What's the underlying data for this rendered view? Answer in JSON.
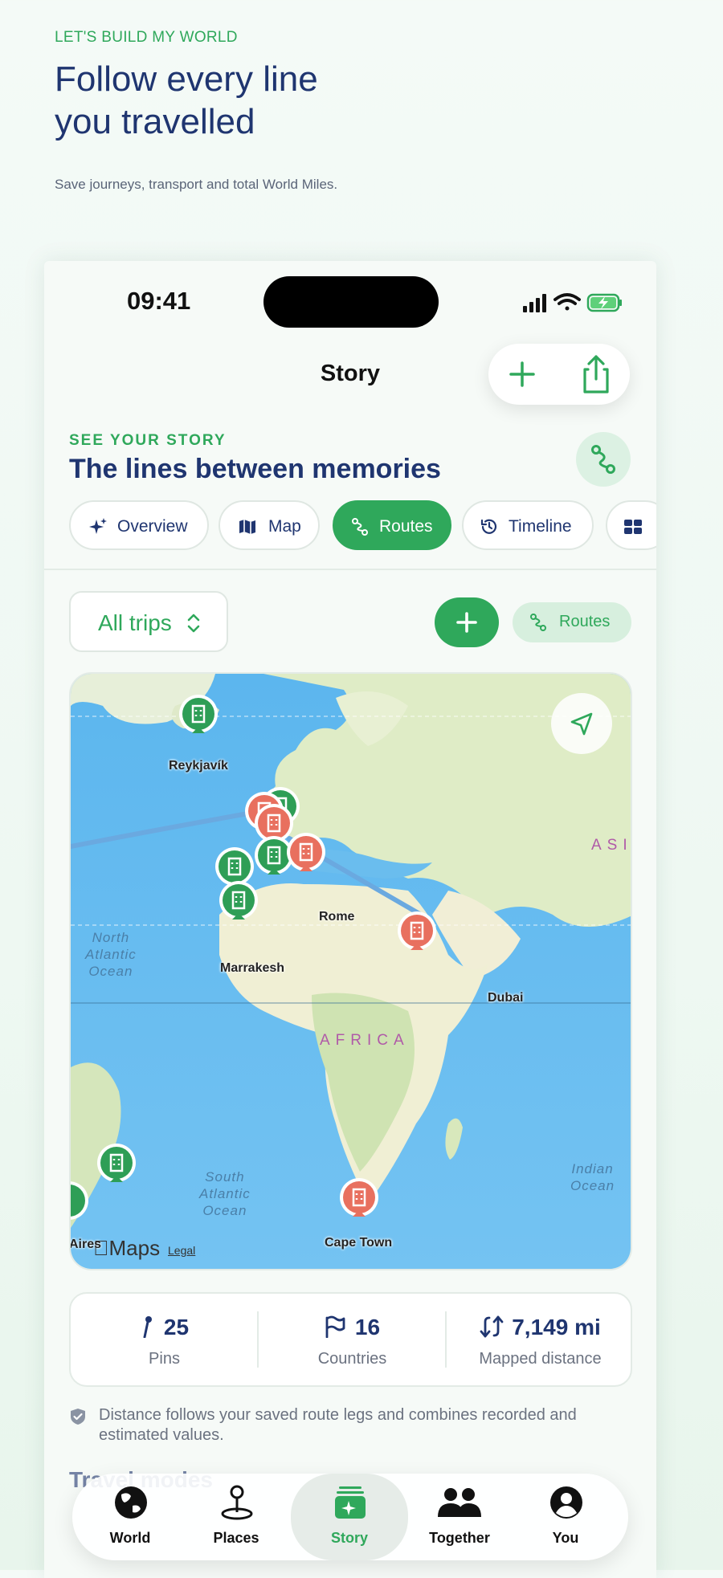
{
  "promo": {
    "eyebrow": "LET'S BUILD MY WORLD",
    "title_line1": "Follow every line",
    "title_line2": "you travelled",
    "subtitle": "Save journeys, transport and total World Miles."
  },
  "status_bar": {
    "time": "09:41"
  },
  "nav": {
    "title": "Story",
    "icons": [
      "plus-icon",
      "share-icon"
    ]
  },
  "section": {
    "eyebrow": "SEE YOUR STORY",
    "title": "The lines between memories",
    "icon": "route-icon"
  },
  "tabs": [
    {
      "label": "Overview",
      "icon": "sparkle-icon"
    },
    {
      "label": "Map",
      "icon": "map-icon"
    },
    {
      "label": "Routes",
      "icon": "route-icon",
      "active": true
    },
    {
      "label": "Timeline",
      "icon": "history-icon"
    },
    {
      "label": "",
      "icon": "grid-icon"
    }
  ],
  "filter": {
    "label": "All trips"
  },
  "routes_chip": {
    "label": "Routes"
  },
  "map": {
    "labels": {
      "reykjavik": "Reykjavík",
      "rome": "Rome",
      "marrakesh": "Marrakesh",
      "dubai": "Dubai",
      "cape_town": "Cape Town",
      "aires": "Aires"
    },
    "oceans": {
      "north_atlantic": "North\nAtlantic\nOcean",
      "south_atlantic": "South\nAtlantic\nOcean",
      "indian": "Indian\nOcean"
    },
    "regions": {
      "africa": "AFRICA",
      "asia": "ASI"
    },
    "brand": "Maps",
    "legal": "Legal",
    "colors": {
      "visited": "#2e9e56",
      "planned": "#e8705f",
      "route": "#6aa9e0"
    }
  },
  "stats": [
    {
      "value": "25",
      "caption": "Pins",
      "icon": "pin-icon"
    },
    {
      "value": "16",
      "caption": "Countries",
      "icon": "flag-icon"
    },
    {
      "value": "7,149 mi",
      "caption": "Mapped distance",
      "icon": "distance-icon"
    }
  ],
  "note": "Distance follows your saved route legs and combines recorded and estimated values.",
  "peek_heading": "Travel modes",
  "tabbar": [
    {
      "label": "World",
      "icon": "globe-icon"
    },
    {
      "label": "Places",
      "icon": "places-icon"
    },
    {
      "label": "Story",
      "icon": "story-icon",
      "active": true
    },
    {
      "label": "Together",
      "icon": "people-icon"
    },
    {
      "label": "You",
      "icon": "person-icon"
    }
  ],
  "colors": {
    "accent": "#2fa85b",
    "navy": "#1f3570"
  }
}
